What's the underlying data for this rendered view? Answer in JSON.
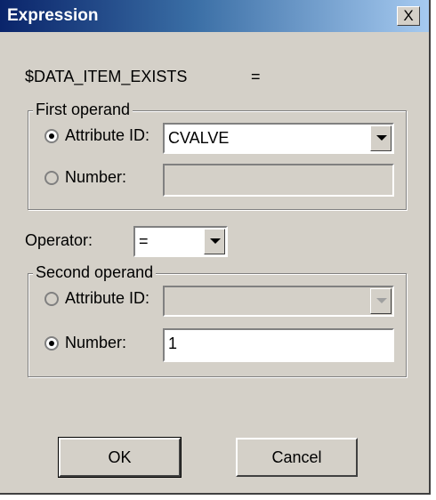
{
  "window": {
    "title": "Expression",
    "close_label": "X"
  },
  "expression": {
    "name": "$DATA_ITEM_EXISTS",
    "operator": "="
  },
  "first_operand": {
    "legend": "First operand",
    "attribute_label": "Attribute ID:",
    "attribute_value": "CVALVE",
    "attribute_selected": true,
    "number_label": "Number:",
    "number_value": "",
    "number_selected": false
  },
  "operator": {
    "label": "Operator:",
    "value": "="
  },
  "second_operand": {
    "legend": "Second operand",
    "attribute_label": "Attribute ID:",
    "attribute_value": "",
    "attribute_selected": false,
    "number_label": "Number:",
    "number_value": "1",
    "number_selected": true
  },
  "buttons": {
    "ok": "OK",
    "cancel": "Cancel"
  },
  "icons": {
    "close": "close-icon",
    "radio": "radio-button",
    "dropdown": "chevron-down-icon"
  },
  "colors": {
    "titlebar_start": "#0a246a",
    "titlebar_end": "#a6caf0",
    "dialog_bg": "#d4d0c8"
  }
}
